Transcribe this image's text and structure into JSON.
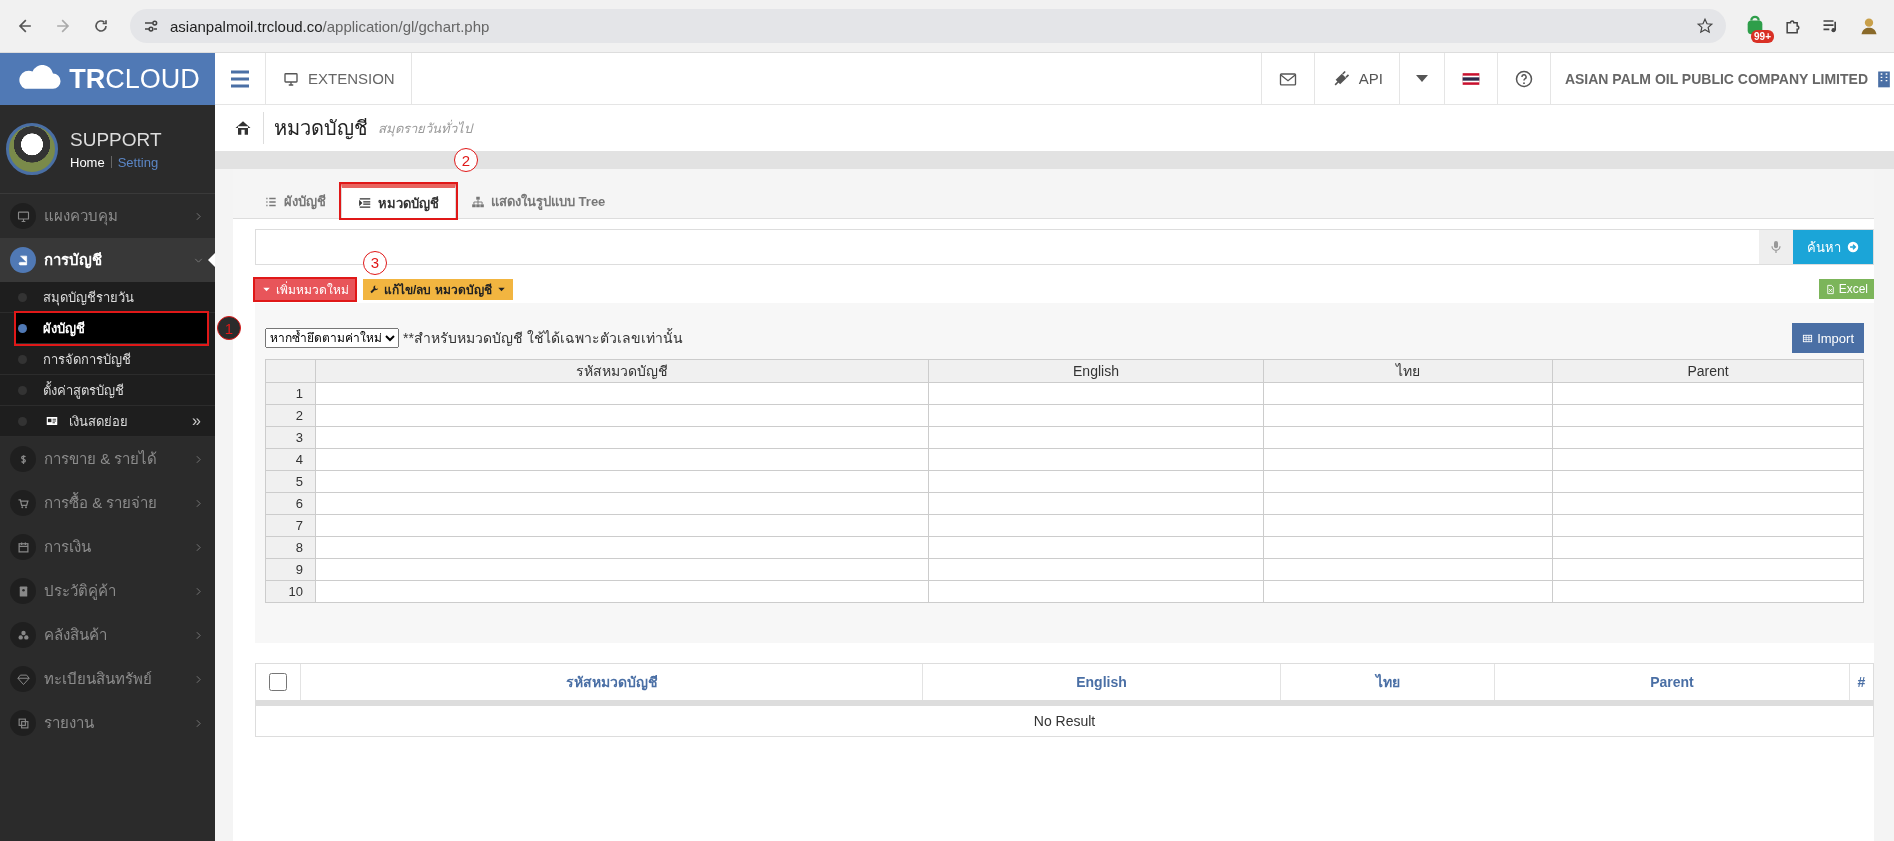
{
  "browser": {
    "url_host": "asianpalmoil.trcloud.co",
    "url_path": "/application/gl/gchart.php",
    "badge": "99+"
  },
  "sidebar": {
    "logo": "**TR**CLOUD",
    "user": {
      "name": "SUPPORT",
      "links": [
        {
          "label": "Home",
          "kind": "plain"
        },
        {
          "label": "Setting",
          "kind": "link"
        }
      ]
    },
    "items": [
      {
        "label": "แผงควบคุม",
        "expanded": false,
        "selected": false
      },
      {
        "label": "การบัญชี",
        "expanded": true,
        "selected": true,
        "children": [
          {
            "label": "สมุดบัญชีรายวัน",
            "selected": false
          },
          {
            "label": "ผังบัญชี",
            "selected": true,
            "annotation": "1"
          },
          {
            "label": "การจัดการบัญชี",
            "selected": false
          },
          {
            "label": "ตั้งค่าสูตรบัญชี",
            "selected": false
          },
          {
            "label": "เงินสดย่อย",
            "selected": false,
            "more": "»"
          }
        ]
      },
      {
        "label": "การขาย & รายได้",
        "expanded": false,
        "selected": false
      },
      {
        "label": "การซื้อ & รายจ่าย",
        "expanded": false,
        "selected": false
      },
      {
        "label": "การเงิน",
        "expanded": false,
        "selected": false
      },
      {
        "label": "ประวัติคู่ค้า",
        "expanded": false,
        "selected": false
      },
      {
        "label": "คลังสินค้า",
        "expanded": false,
        "selected": false
      },
      {
        "label": "ทะเบียนสินทรัพย์",
        "expanded": false,
        "selected": false
      },
      {
        "label": "รายงาน",
        "expanded": false,
        "selected": false
      }
    ]
  },
  "header": {
    "extension": "EXTENSION",
    "api": "API",
    "company": "ASIAN PALM OIL PUBLIC COMPANY LIMITED"
  },
  "page": {
    "title": "หมวดบัญชี",
    "subtitle": "สมุดรายวันทั่วไป"
  },
  "tabs": [
    {
      "label": "ผังบัญชี",
      "selected": false
    },
    {
      "label": "หมวดบัญชี",
      "selected": true,
      "annotation": "2"
    },
    {
      "label": "แสดงในรูปแบบ Tree",
      "selected": false
    }
  ],
  "search": {
    "button": "ค้นหา"
  },
  "actions": [
    {
      "label": "เพิ่มหมวดใหม่",
      "kind": "add",
      "annotation": "3"
    },
    {
      "label": "แก้ไข/ลบ หมวดบัญชี",
      "kind": "edit"
    }
  ],
  "excel": "Excel",
  "import_form": {
    "mode": "หากซ้ำยึดตามค่าใหม่",
    "note": "**สำหรับหมวดบัญชี ใช้ได้เฉพาะตัวเลขเท่านั้น",
    "button": "Import",
    "columns": [
      "รหัสหมวดบัญชี",
      "English",
      "ไทย",
      "Parent"
    ],
    "rows": [
      "1",
      "2",
      "3",
      "4",
      "5",
      "6",
      "7",
      "8",
      "9",
      "10"
    ]
  },
  "results": {
    "columns": [
      "รหัสหมวดบัญชี",
      "English",
      "ไทย",
      "Parent",
      "#"
    ],
    "checked": false,
    "empty": "No Result"
  }
}
